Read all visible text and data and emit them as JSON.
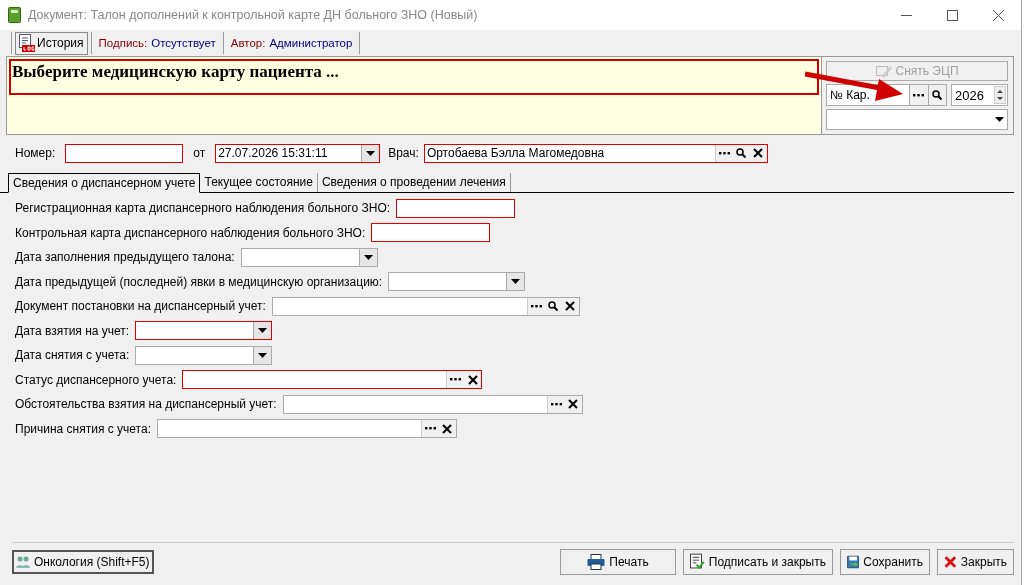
{
  "window": {
    "title": "Документ: Талон дополнений к контрольной карте ДН больного ЗНО (Новый)"
  },
  "toolbar": {
    "history_button": "История",
    "signature": {
      "label": "Подпись:",
      "value": "Отсутствует"
    },
    "author": {
      "label": "Автор:",
      "value": "Администратор"
    }
  },
  "message": "Выберите медицинскую карту пациента ...",
  "card_panel": {
    "remove_signature_button": {
      "label": "Снять ЭЦП",
      "disabled": true
    },
    "card_field": {
      "placeholder": "№ Кар."
    },
    "year": "2026"
  },
  "header_fields": {
    "number": {
      "label": "Номер:",
      "required": true
    },
    "date": {
      "label": "от",
      "value": "27.07.2026 15:31:11",
      "required": true
    },
    "doctor": {
      "label": "Врач:",
      "value": "Ортобаева Бэлла Магомедовна",
      "required": true
    }
  },
  "tabs": [
    {
      "label": "Сведения о диспансерном учете",
      "selected": true
    },
    {
      "label": "Текущее состояние",
      "selected": false
    },
    {
      "label": "Сведения о проведении лечения",
      "selected": false
    }
  ],
  "form": [
    {
      "label": "Регистрационная карта диспансерного наблюдения больного ЗНО:",
      "kind": "text",
      "required": true
    },
    {
      "label": "Контрольная карта диспансерного наблюдения больного ЗНО:",
      "kind": "text",
      "required": true
    },
    {
      "label": "Дата заполнения предыдущего талона:",
      "kind": "date",
      "required": false
    },
    {
      "label": "Дата предыдущей (последней) явки в медицинскую организацию:",
      "kind": "date",
      "required": false
    },
    {
      "label": "Документ постановки на диспансерный учет:",
      "kind": "lookup",
      "search": true,
      "required": false
    },
    {
      "label": "Дата взятия на учет:",
      "kind": "date",
      "required": true
    },
    {
      "label": "Дата снятия с учета:",
      "kind": "date",
      "required": false
    },
    {
      "label": "Статус диспансерного учета:",
      "kind": "lookup",
      "search": false,
      "required": true
    },
    {
      "label": "Обстоятельства взятия на диспансерный учет:",
      "kind": "lookup",
      "search": false,
      "required": false
    },
    {
      "label": "Причина снятия с учета:",
      "kind": "lookup",
      "search": false,
      "required": false
    }
  ],
  "footer": {
    "oncology_button": "Онкология (Shift+F5)",
    "buttons": [
      {
        "kind": "print",
        "label": "Печать"
      },
      {
        "kind": "sign",
        "label": "Подписать и закрыть"
      },
      {
        "kind": "save",
        "label": "Сохранить"
      },
      {
        "kind": "close",
        "label": "Закрыть"
      }
    ]
  }
}
